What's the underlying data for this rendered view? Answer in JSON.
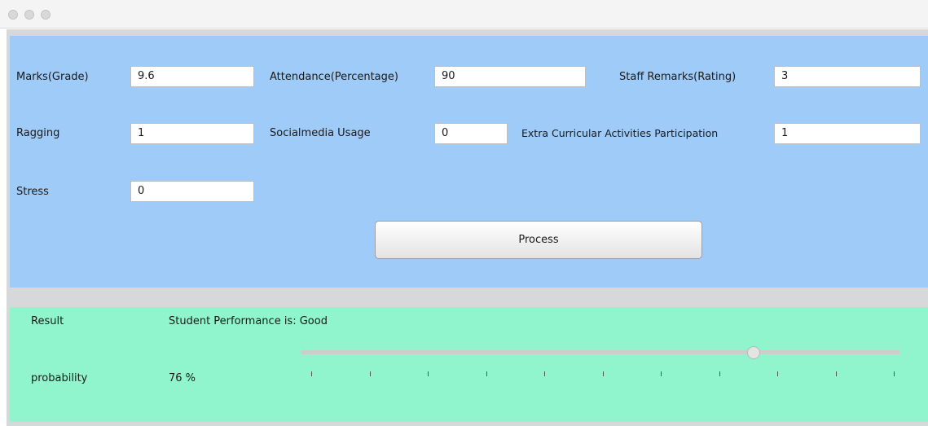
{
  "window": {
    "controls": [
      "close",
      "minimize",
      "zoom"
    ]
  },
  "form": {
    "marks": {
      "label": "Marks(Grade)",
      "value": "9.6"
    },
    "attendance": {
      "label": "Attendance(Percentage)",
      "value": "90"
    },
    "staff_remarks": {
      "label": "Staff Remarks(Rating)",
      "value": "3"
    },
    "ragging": {
      "label": "Ragging",
      "value": "1"
    },
    "socialmedia": {
      "label": "Socialmedia Usage",
      "value": "0"
    },
    "extra_curricular": {
      "label": "Extra Curricular Activities Participation",
      "value": "1"
    },
    "stress": {
      "label": "Stress",
      "value": "0"
    },
    "process_label": "Process"
  },
  "result": {
    "result_label": "Result",
    "result_text": "Student Performance is: Good",
    "probability_label": "probability",
    "probability_text": "76 %",
    "slider": {
      "min": 0,
      "max": 100,
      "value": 76,
      "major_tick_count": 11
    }
  }
}
